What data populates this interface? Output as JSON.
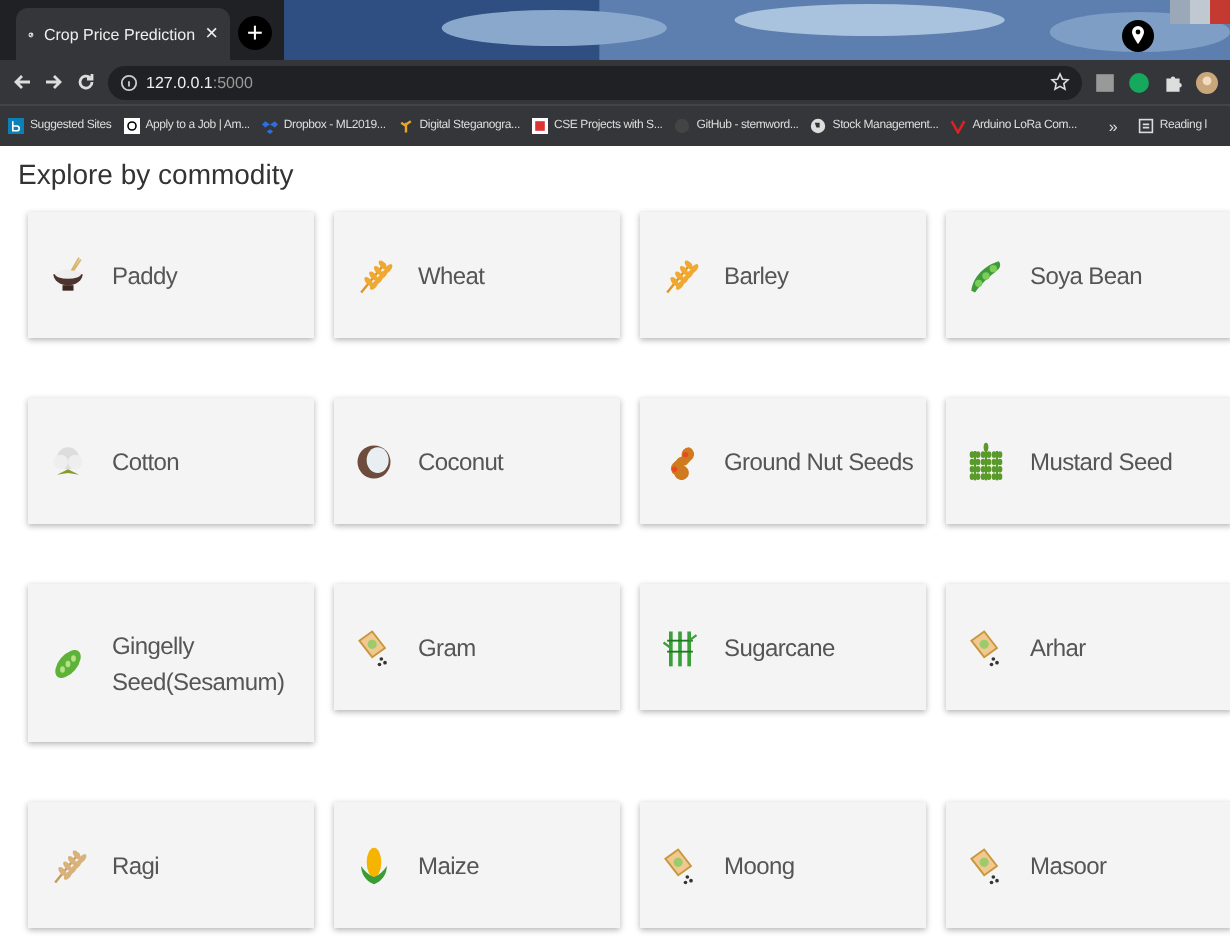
{
  "browser": {
    "tab": {
      "title": "Crop Price Prediction",
      "close": "×"
    },
    "new_tab": "+",
    "address": {
      "host": "127.0.0.1",
      "port": ":5000"
    },
    "bookmarks": [
      {
        "label": "Suggested Sites",
        "kind": "b"
      },
      {
        "label": "Apply to a Job | Am...",
        "kind": "a"
      },
      {
        "label": "Dropbox - ML2019...",
        "kind": "dropbox"
      },
      {
        "label": "Digital Steganogra...",
        "kind": "leaf"
      },
      {
        "label": "CSE Projects with S...",
        "kind": "red"
      },
      {
        "label": "GitHub - stemword...",
        "kind": "github"
      },
      {
        "label": "Stock Management...",
        "kind": "globe"
      },
      {
        "label": "Arduino LoRa Com...",
        "kind": "v"
      }
    ],
    "more": "»",
    "reading_list": "Reading l"
  },
  "heading": "Explore by commodity",
  "commodities": [
    {
      "name": "Paddy",
      "kind": "bowl"
    },
    {
      "name": "Wheat",
      "kind": "ear"
    },
    {
      "name": "Barley",
      "kind": "barley"
    },
    {
      "name": "Soya Bean",
      "kind": "pod"
    },
    {
      "name": "Cotton",
      "kind": "cotton"
    },
    {
      "name": "Coconut",
      "kind": "coconut"
    },
    {
      "name": "Ground Nut Seeds",
      "kind": "peanut"
    },
    {
      "name": "Mustard Seed",
      "kind": "mustard"
    },
    {
      "name": "Gingelly Seed(Sesamum)",
      "kind": "sesame"
    },
    {
      "name": "Gram",
      "kind": "packet"
    },
    {
      "name": "Sugarcane",
      "kind": "cane"
    },
    {
      "name": "Arhar",
      "kind": "packet"
    },
    {
      "name": "Ragi",
      "kind": "ragi"
    },
    {
      "name": "Maize",
      "kind": "corn"
    },
    {
      "name": "Moong",
      "kind": "packet"
    },
    {
      "name": "Masoor",
      "kind": "packet"
    }
  ]
}
